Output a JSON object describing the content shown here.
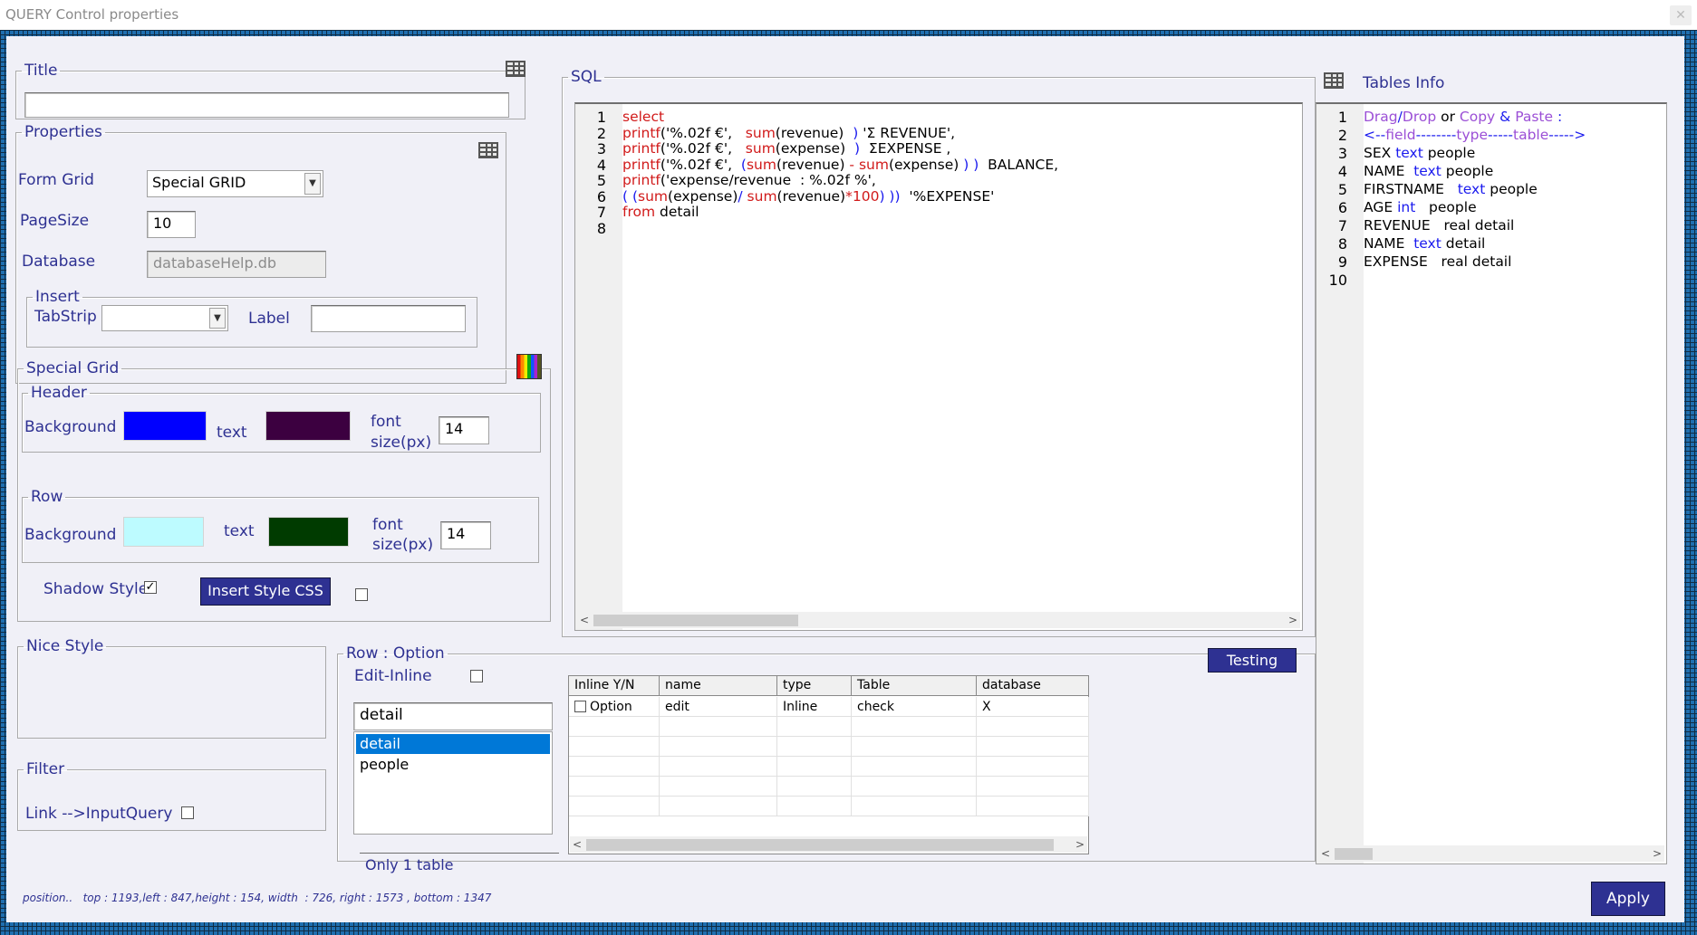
{
  "window": {
    "title": "QUERY Control properties",
    "close_symbol": "✕"
  },
  "title_group": {
    "legend": "Title",
    "value": ""
  },
  "properties": {
    "legend": "Properties",
    "form_grid_label": "Form Grid",
    "form_grid_value": "Special GRID",
    "pagesize_label": "PageSize",
    "pagesize_value": "10",
    "database_label": "Database",
    "database_value": "databaseHelp.db",
    "insert_legend": "Insert",
    "tabstrip_label": "TabStrip",
    "tabstrip_value": "",
    "label_label": "Label",
    "label_value": ""
  },
  "special_grid": {
    "legend": "Special Grid",
    "header_legend": "Header",
    "header_bg_label": "Background",
    "header_bg_color": "#0000ff",
    "header_text_label": "text",
    "header_text_color": "#3c0040",
    "header_font_label_1": "font",
    "header_font_label_2": "size(px)",
    "header_font_value": "14",
    "row_legend": "Row",
    "row_bg_label": "Background",
    "row_bg_color": "#bdfbff",
    "row_text_label": "text",
    "row_text_color": "#003b00",
    "row_font_label_1": "font",
    "row_font_label_2": "size(px)",
    "row_font_value": "14",
    "shadow_style_label": "Shadow Style",
    "shadow_style_checked": "✓",
    "insert_style_button": "Insert Style CSS"
  },
  "nice_style": {
    "legend": "Nice Style"
  },
  "filter": {
    "legend": "Filter",
    "link_label": "Link -->InputQuery"
  },
  "sql": {
    "legend": "SQL",
    "line_numbers": [
      "1",
      "2",
      "3",
      "4",
      "5",
      "6",
      "7",
      "8"
    ],
    "lines": [
      [
        {
          "t": "select",
          "c": "red"
        }
      ],
      [
        {
          "t": "printf",
          "c": "red"
        },
        {
          "t": "('%.02f €',   ",
          "c": ""
        },
        {
          "t": "sum",
          "c": "red"
        },
        {
          "t": "(revenue)  ",
          "c": ""
        },
        {
          "t": ")",
          "c": "blue"
        },
        {
          "t": " 'Σ REVENUE',",
          "c": ""
        }
      ],
      [
        {
          "t": "printf",
          "c": "red"
        },
        {
          "t": "('%.02f €',   ",
          "c": ""
        },
        {
          "t": "sum",
          "c": "red"
        },
        {
          "t": "(expense)  ",
          "c": ""
        },
        {
          "t": ")",
          "c": "blue"
        },
        {
          "t": "  ΣEXPENSE ,",
          "c": ""
        }
      ],
      [
        {
          "t": "printf",
          "c": "red"
        },
        {
          "t": "('%.02f €',  ",
          "c": ""
        },
        {
          "t": "(",
          "c": "blue"
        },
        {
          "t": "sum",
          "c": "red"
        },
        {
          "t": "(revenue) ",
          "c": ""
        },
        {
          "t": "-",
          "c": "red"
        },
        {
          "t": " ",
          "c": ""
        },
        {
          "t": "sum",
          "c": "red"
        },
        {
          "t": "(expense) ",
          "c": ""
        },
        {
          "t": ") )",
          "c": "blue"
        },
        {
          "t": "  BALANCE,",
          "c": ""
        }
      ],
      [
        {
          "t": "printf",
          "c": "red"
        },
        {
          "t": "('expense/revenue  : %.02f %',",
          "c": ""
        }
      ],
      [
        {
          "t": "( (",
          "c": "blue"
        },
        {
          "t": "sum",
          "c": "red"
        },
        {
          "t": "(expense)",
          "c": ""
        },
        {
          "t": "/",
          "c": "blue"
        },
        {
          "t": " ",
          "c": ""
        },
        {
          "t": "sum",
          "c": "red"
        },
        {
          "t": "(revenue)",
          "c": ""
        },
        {
          "t": "*100",
          "c": "red"
        },
        {
          "t": ") ))",
          "c": "blue"
        },
        {
          "t": "  '%EXPENSE'",
          "c": ""
        }
      ],
      [
        {
          "t": "from",
          "c": "red"
        },
        {
          "t": " detail",
          "c": ""
        }
      ],
      []
    ]
  },
  "tables_info": {
    "title": "Tables Info",
    "line_numbers": [
      "1",
      "2",
      "3",
      "4",
      "5",
      "6",
      "7",
      "8",
      "9",
      "10"
    ],
    "lines": [
      [
        {
          "t": "Drag",
          "c": "purple"
        },
        {
          "t": "/",
          "c": "blue"
        },
        {
          "t": "Drop",
          "c": "purple"
        },
        {
          "t": " or ",
          "c": ""
        },
        {
          "t": "Copy",
          "c": "purple"
        },
        {
          "t": " & ",
          "c": "blue"
        },
        {
          "t": "Paste",
          "c": "purple"
        },
        {
          "t": " :",
          "c": "blue"
        }
      ],
      [
        {
          "t": "<--",
          "c": "blue"
        },
        {
          "t": "field",
          "c": "purple"
        },
        {
          "t": "--------",
          "c": "blue"
        },
        {
          "t": "type",
          "c": "purple"
        },
        {
          "t": "-----",
          "c": "blue"
        },
        {
          "t": "table",
          "c": "purple"
        },
        {
          "t": "----->",
          "c": "blue"
        }
      ],
      [
        {
          "t": "SEX ",
          "c": ""
        },
        {
          "t": "text",
          "c": "blue"
        },
        {
          "t": " people",
          "c": ""
        }
      ],
      [
        {
          "t": "NAME  ",
          "c": ""
        },
        {
          "t": "text",
          "c": "blue"
        },
        {
          "t": " people",
          "c": ""
        }
      ],
      [
        {
          "t": "FIRSTNAME   ",
          "c": ""
        },
        {
          "t": "text",
          "c": "blue"
        },
        {
          "t": " people",
          "c": ""
        }
      ],
      [
        {
          "t": "AGE ",
          "c": ""
        },
        {
          "t": "int",
          "c": "blue"
        },
        {
          "t": "   people",
          "c": ""
        }
      ],
      [
        {
          "t": "REVENUE   real detail",
          "c": ""
        }
      ],
      [
        {
          "t": "NAME  ",
          "c": ""
        },
        {
          "t": "text",
          "c": "blue"
        },
        {
          "t": " detail",
          "c": ""
        }
      ],
      [
        {
          "t": "EXPENSE   real detail",
          "c": ""
        }
      ],
      []
    ]
  },
  "row_option": {
    "legend": "Row :  Option",
    "edit_inline_label": "Edit-Inline",
    "table_input_value": "detail",
    "table_list": [
      "detail",
      "people"
    ],
    "selected_index": 0,
    "note": "Only 1 table",
    "testing_button": "Testing",
    "grid_headers": [
      "Inline Y/N",
      "name",
      "type",
      "Table",
      "database"
    ],
    "grid_rows": [
      [
        "Option",
        "edit",
        "Inline",
        "check",
        "X"
      ]
    ]
  },
  "status_text": "position..   top : 1193,left : 847,height : 154, width  : 726, right : 1573 , bottom : 1347",
  "apply_button": "Apply"
}
